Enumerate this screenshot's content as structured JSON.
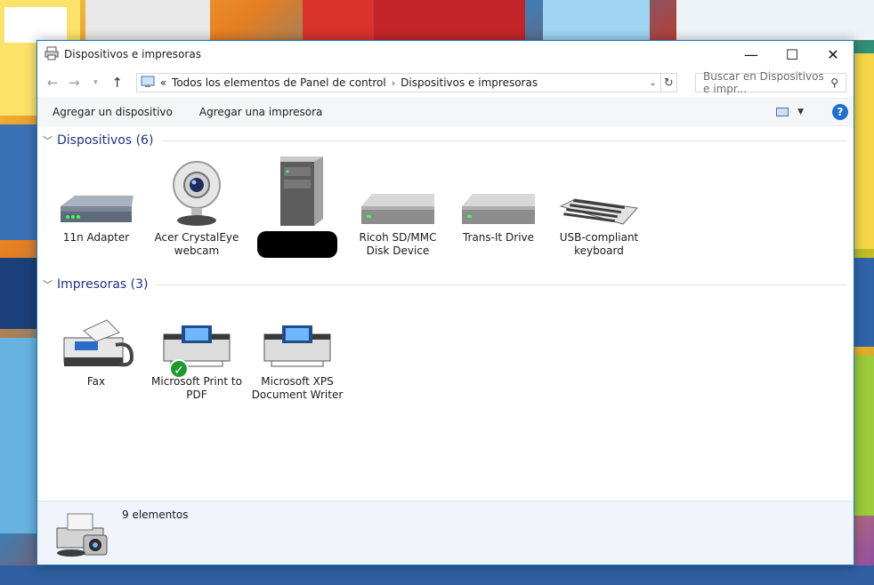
{
  "window": {
    "title": "Dispositivos e impresoras",
    "controls": {
      "minimize": "—",
      "maximize": "☐",
      "close": "✕"
    }
  },
  "address": {
    "prefix": "«",
    "crumbs": [
      "Todos los elementos de Panel de control",
      "Dispositivos e impresoras"
    ],
    "search_placeholder": "Buscar en Dispositivos e impr..."
  },
  "toolbar": {
    "add_device": "Agregar un dispositivo",
    "add_printer": "Agregar una impresora",
    "help": "?"
  },
  "groups": {
    "devices": {
      "label": "Dispositivos (6)",
      "items": [
        {
          "label": "11n Adapter",
          "icon": "network-adapter-icon"
        },
        {
          "label": "Acer CrystalEye webcam",
          "icon": "webcam-icon"
        },
        {
          "label": "",
          "icon": "computer-tower-icon",
          "redacted": true
        },
        {
          "label": "Ricoh SD/MMC Disk Device",
          "icon": "disk-drive-icon"
        },
        {
          "label": "Trans-It Drive",
          "icon": "disk-drive-icon"
        },
        {
          "label": "USB-compliant keyboard",
          "icon": "keyboard-icon"
        }
      ]
    },
    "printers": {
      "label": "Impresoras (3)",
      "items": [
        {
          "label": "Fax",
          "icon": "fax-icon"
        },
        {
          "label": "Microsoft Print to PDF",
          "icon": "printer-icon",
          "default": true
        },
        {
          "label": "Microsoft XPS Document Writer",
          "icon": "printer-icon"
        }
      ]
    }
  },
  "status": {
    "count": "9 elementos"
  }
}
